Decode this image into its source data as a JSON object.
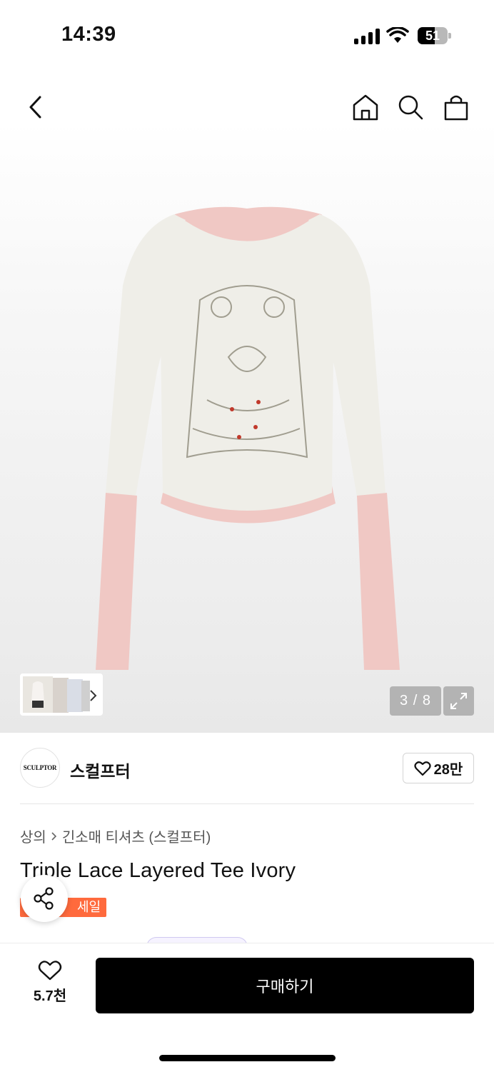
{
  "status_bar": {
    "time": "14:39",
    "battery": "51"
  },
  "gallery": {
    "pager": "3 / 8"
  },
  "brand": {
    "logo_text": "SCULPTOR",
    "name": "스컬프터",
    "likes": "28만"
  },
  "breadcrumb": {
    "category": "상의",
    "subcategory": "긴소매 티셔츠 (스컬프터)"
  },
  "product": {
    "title": "Triple Lace Layered Tee Ivory",
    "sale_badge": "세일"
  },
  "bottom_bar": {
    "wish_count": "5.7천",
    "buy_label": "구매하기"
  },
  "colors": {
    "sale": "#ff6a3d",
    "shirt_body": "#efeee8",
    "lace_pink": "#f0c8c4",
    "button": "#000000"
  },
  "icons": [
    "back-icon",
    "home-icon",
    "search-icon",
    "shopping-bag-icon",
    "expand-icon",
    "chevron-right-icon",
    "heart-icon",
    "share-icon"
  ]
}
